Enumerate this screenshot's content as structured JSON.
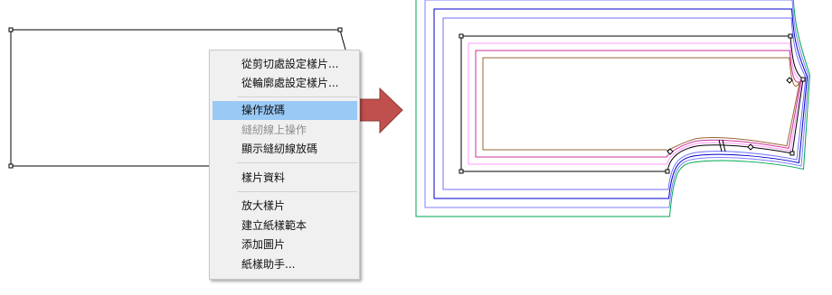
{
  "context_menu": {
    "items": [
      {
        "label": "從剪切處設定樣片...",
        "state": "normal"
      },
      {
        "label": "從輪廓處設定樣片...",
        "state": "normal"
      },
      {
        "label": "操作放碼",
        "state": "highlighted"
      },
      {
        "label": "縫紉線上操作",
        "state": "disabled"
      },
      {
        "label": "顯示縫紉線放碼",
        "state": "normal"
      },
      {
        "label": "樣片資料",
        "state": "normal"
      },
      {
        "label": "放大樣片",
        "state": "normal"
      },
      {
        "label": "建立紙樣範本",
        "state": "normal"
      },
      {
        "label": "添加圖片",
        "state": "normal"
      },
      {
        "label": "紙樣助手...",
        "state": "normal"
      }
    ],
    "highlight_color": "#99c9f5"
  },
  "arrow": {
    "color": "#c0504d",
    "icon": "right-arrow-icon"
  },
  "grade_colors": [
    "#00a651",
    "#7f7fff",
    "#0000cc",
    "#6f6fff",
    "#000000",
    "#ff99ff",
    "#cc3399",
    "#996633"
  ]
}
